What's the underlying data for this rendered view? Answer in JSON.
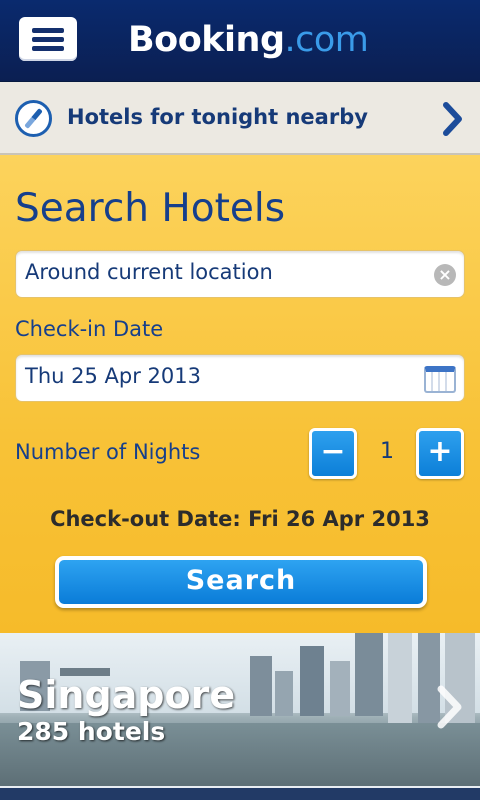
{
  "header": {
    "logo_primary": "Booking",
    "logo_secondary": ".com",
    "menu_icon": "hamburger-menu-icon"
  },
  "nearby": {
    "label": "Hotels for tonight nearby",
    "icon": "compass-icon"
  },
  "search": {
    "title": "Search Hotels",
    "location_value": "Around current location",
    "checkin_label": "Check-in Date",
    "checkin_value": "Thu 25 Apr 2013",
    "nights_label": "Number of Nights",
    "nights_value": "1",
    "minus_label": "−",
    "plus_label": "+",
    "checkout_text": "Check-out Date: Fri 26 Apr 2013",
    "button_label": "Search"
  },
  "destination": {
    "name": "Singapore",
    "count": "285 hotels"
  },
  "colors": {
    "header_bg": "#0b1f52",
    "accent_blue": "#0c7fd8",
    "panel_yellow": "#f8c237",
    "title_blue": "#163f8c"
  }
}
